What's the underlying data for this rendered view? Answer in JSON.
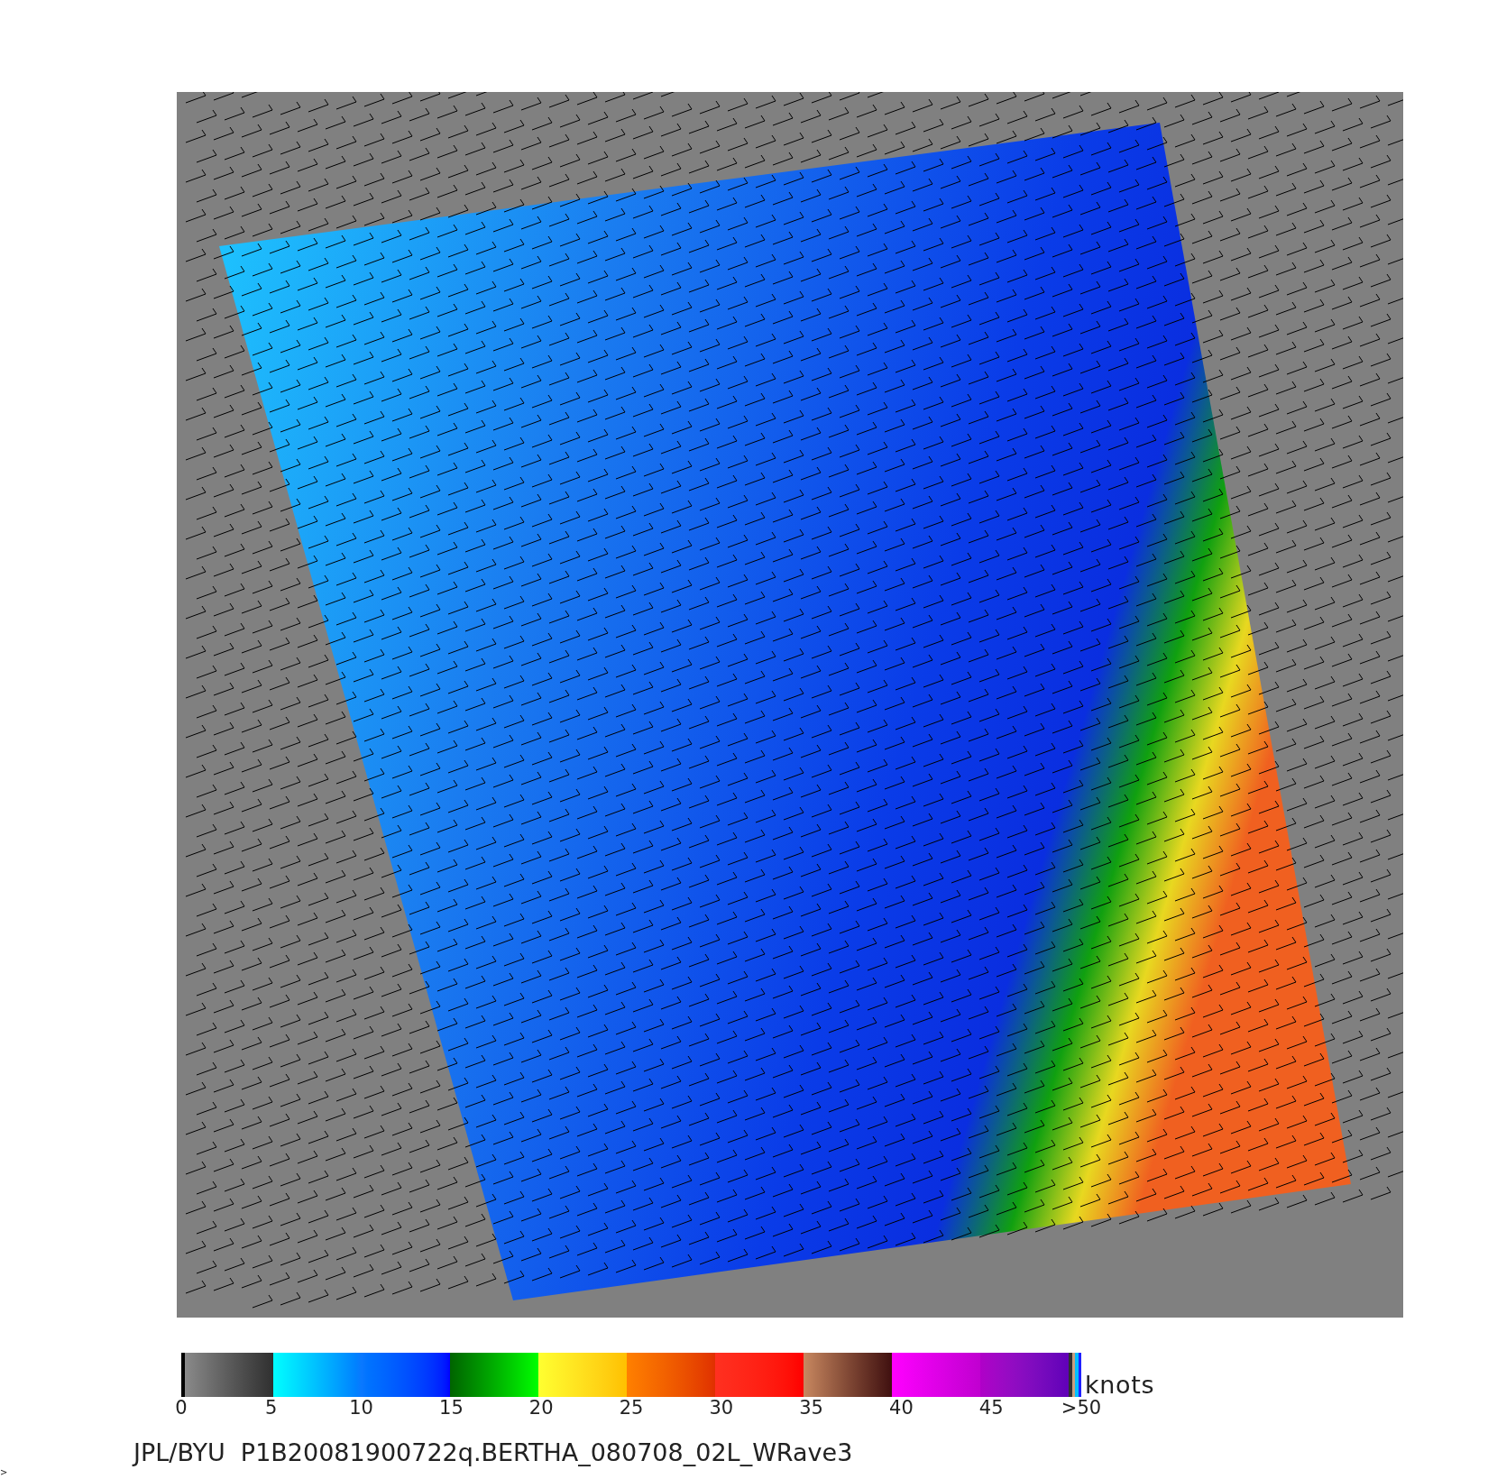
{
  "colorbar": {
    "ticks": [
      "0",
      "5",
      "10",
      "15",
      "20",
      "25",
      "30",
      "35",
      "40",
      "45",
      ">50"
    ],
    "unit": "knots"
  },
  "caption": "JPL/BYU  P1B20081900722q.BERTHA_080708_02L_WRave3",
  "corner_mark": ">"
}
